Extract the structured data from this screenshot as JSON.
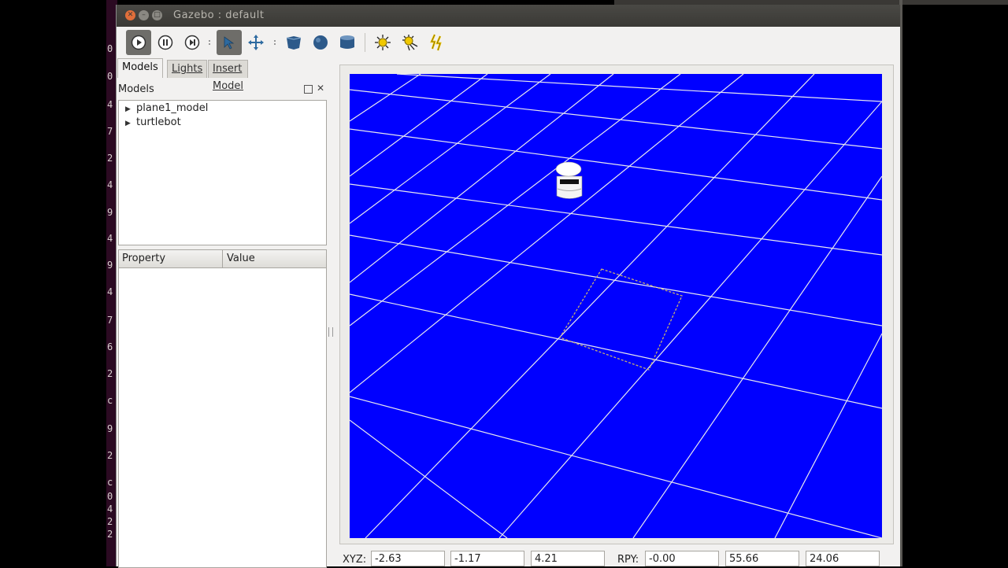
{
  "window": {
    "title": "Gazebo : default"
  },
  "terminal_lines": [
    "0",
    "0",
    "4",
    "7",
    "2",
    "4",
    "9",
    "4",
    "9",
    "4",
    "7",
    "6",
    "2",
    "c",
    "9",
    "2",
    "c",
    "0",
    "4",
    "2",
    "2"
  ],
  "toolbar": {
    "items": [
      {
        "name": "play-icon",
        "active": true
      },
      {
        "name": "pause-icon",
        "active": false
      },
      {
        "name": "step-icon",
        "active": false
      },
      {
        "name": "select-arrow-icon",
        "active": true
      },
      {
        "name": "translate-icon",
        "active": false
      },
      {
        "name": "box-shape-icon",
        "active": false
      },
      {
        "name": "sphere-shape-icon",
        "active": false
      },
      {
        "name": "cylinder-shape-icon",
        "active": false
      },
      {
        "name": "point-light-icon",
        "active": false
      },
      {
        "name": "spot-light-icon",
        "active": false
      },
      {
        "name": "directional-light-icon",
        "active": false
      }
    ]
  },
  "tabs": [
    {
      "label": "Models",
      "active": true
    },
    {
      "label": "Lights",
      "active": false
    },
    {
      "label": "Insert Model",
      "active": false
    }
  ],
  "models_panel": {
    "title": "Models",
    "items": [
      {
        "label": "plane1_model"
      },
      {
        "label": "turtlebot"
      }
    ]
  },
  "properties": {
    "columns": [
      "Property",
      "Value"
    ]
  },
  "statusbar": {
    "xyz_label": "XYZ:",
    "xyz": [
      "-2.63",
      "-1.17",
      "4.21"
    ],
    "rpy_label": "RPY:",
    "rpy": [
      "-0.00",
      "55.66",
      "24.06"
    ]
  },
  "colors": {
    "ground": "#0000ff",
    "grid": "#e8e8f0",
    "titlebar": "#3f3e3a",
    "panel": "#f2f1f0",
    "accent_toolbar_icon": "#2d6aa0",
    "light_icon": "#f0c800"
  }
}
